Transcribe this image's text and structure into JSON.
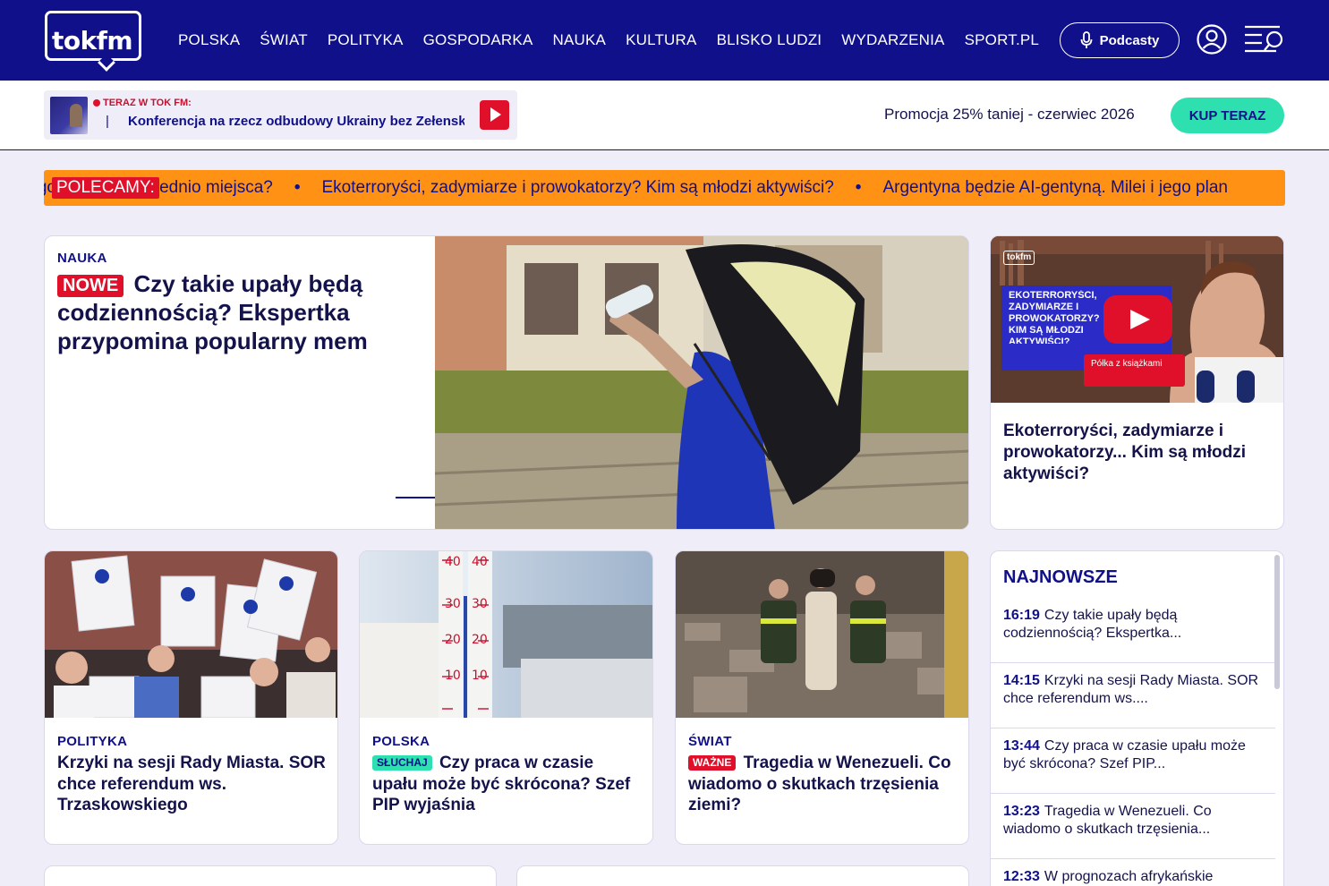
{
  "header": {
    "logo_text": "tokfm",
    "nav": [
      "POLSKA",
      "ŚWIAT",
      "POLITYKA",
      "GOSPODARKA",
      "NAUKA",
      "KULTURA",
      "BLISKO LUDZI",
      "WYDARZENIA",
      "SPORT.PL"
    ],
    "podcast_label": "Podcasty"
  },
  "subbar": {
    "live_label": "TERAZ W TOK FM:",
    "live_pipe": "|",
    "live_title": "Konferencja na rzecz odbudowy Ukrainy bez Zełenskiego",
    "promo_text": "Promocja 25% taniej - czerwiec 2026",
    "buy_label": "KUP TERAZ"
  },
  "ticker": {
    "badge": "POLECAMY:",
    "items": [
      "Czy takie upały będą codziennością? Ekspertka przypomina, gdzie szukać chłodu. Jak przygotować odpowiednio miejsca?",
      "Ekoterroryści, zadymiarze i prowokatorzy? Kim są młodzi aktywiści?",
      "Argentyna będzie AI-gentyną. Milei i jego plan"
    ]
  },
  "hero": {
    "kicker": "NAUKA",
    "badge": "NOWE",
    "title": "Czy takie upały będą codziennością? Ekspertka przypomina popularny mem"
  },
  "video": {
    "overlay_title": "EKOTERRORYŚCI, ZADYMIARZE I PROWOKATORZY? KIM SĄ MŁODZI AKTYWIŚCI?",
    "logo": "tokfm",
    "tag": "Półka z książkami",
    "title": "Ekoterroryści, zadymiarze i prowokatorzy... Kim są młodzi aktywiści?"
  },
  "cards": [
    {
      "kicker": "POLITYKA",
      "badge": "",
      "title": "Krzyki na sesji Rady Miasta. SOR chce referendum ws. Trzaskowskiego"
    },
    {
      "kicker": "POLSKA",
      "badge": "SŁUCHAJ",
      "title": "Czy praca w czasie upału może być skrócona? Szef PIP wyjaśnia"
    },
    {
      "kicker": "ŚWIAT",
      "badge": "WAŻNE",
      "title": "Tragedia w Wenezueli. Co wiadomo o skutkach trzęsienia ziemi?"
    }
  ],
  "newest": {
    "heading": "NAJNOWSZE",
    "items": [
      {
        "time": "16:19",
        "text": "Czy takie upały będą codziennością? Ekspertka..."
      },
      {
        "time": "14:15",
        "text": "Krzyki na sesji Rady Miasta. SOR chce referendum ws...."
      },
      {
        "time": "13:44",
        "text": "Czy praca w czasie upału może być skrócona? Szef PIP..."
      },
      {
        "time": "13:23",
        "text": "Tragedia w Wenezueli. Co wiadomo o skutkach trzęsienia..."
      },
      {
        "time": "12:33",
        "text": "W prognozach afrykańskie"
      }
    ]
  },
  "colors": {
    "brand_navy": "#10108a",
    "accent_red": "#e0102a",
    "accent_mint": "#2ee0b0",
    "ticker_orange": "#ff9214",
    "page_bg": "#eeedf8"
  },
  "icons": [
    "microphone-icon",
    "user-icon",
    "menu-search-icon",
    "play-icon",
    "arrow-right-icon"
  ]
}
